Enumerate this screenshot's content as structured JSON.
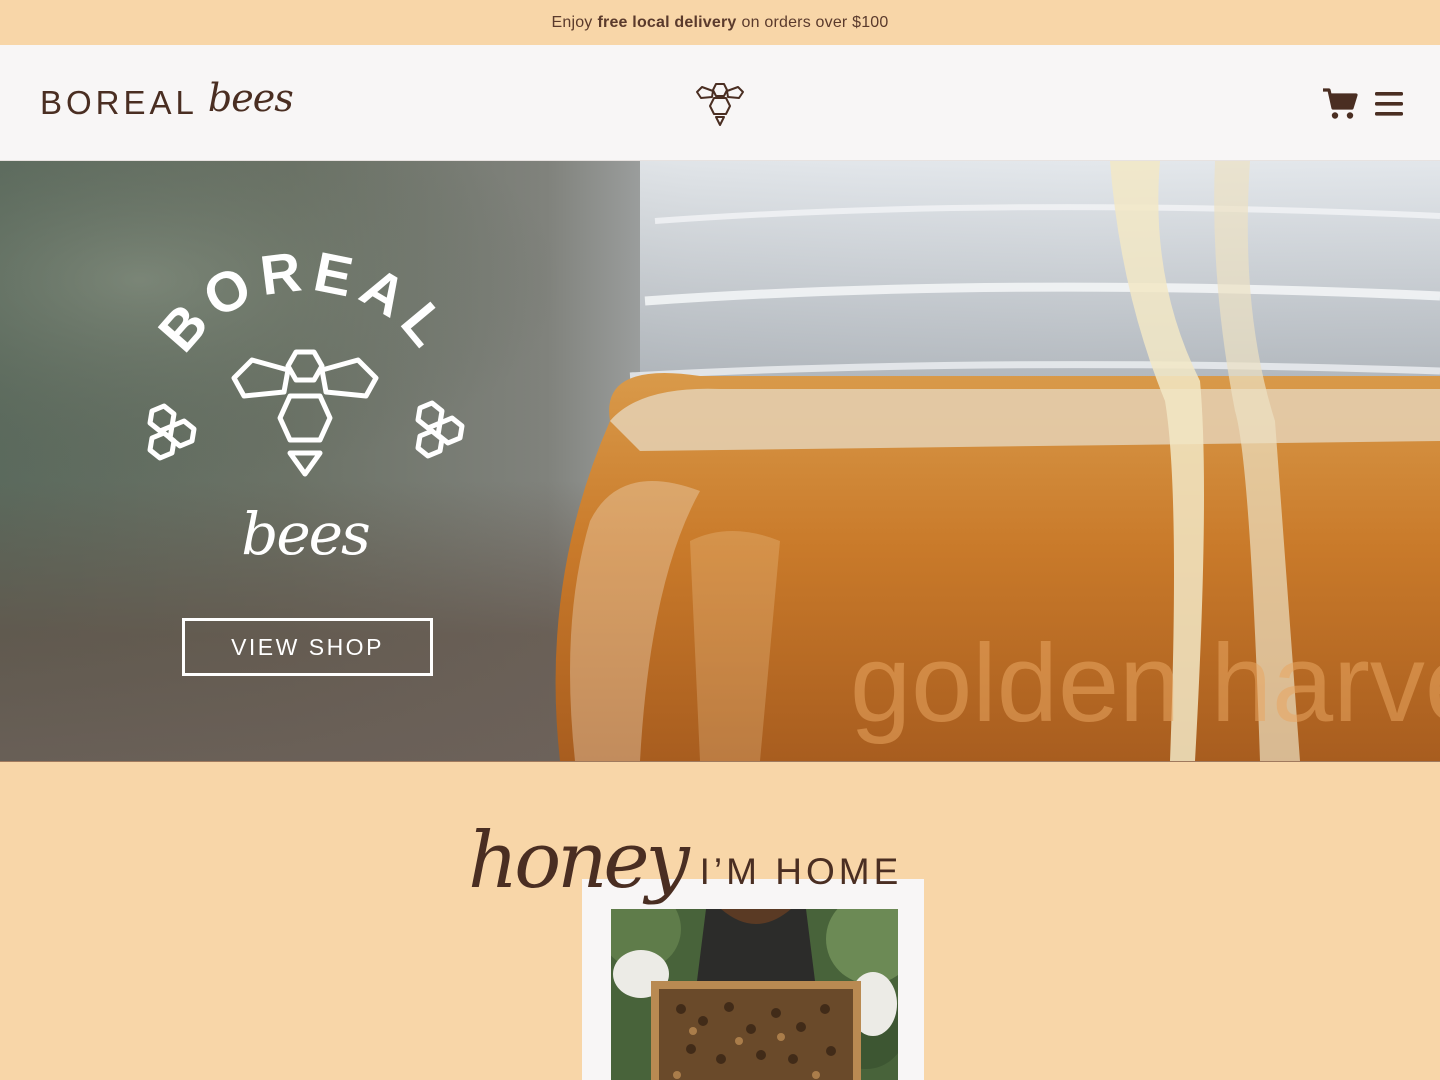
{
  "announcement": {
    "prefix": "Enjoy",
    "highlight": "free local delivery",
    "suffix": "on orders over $100"
  },
  "header": {
    "brand_main": "BOREAL",
    "brand_script": "bees",
    "center_icon": "bee-icon",
    "cart_icon": "cart-icon",
    "menu_icon": "hamburger-menu-icon"
  },
  "hero": {
    "logo_arc_text": "BOREAL",
    "logo_script": "bees",
    "button_label": "VIEW SHOP",
    "jar_embossed_text": "golden harvest"
  },
  "section": {
    "heading_script": "honey",
    "heading_sub": "I’M HOME"
  },
  "colors": {
    "announcement_bg": "#f8d6a8",
    "header_bg": "#f8f6f6",
    "brand_brown": "#4a2e22",
    "section_bg": "#f8d6a8"
  }
}
